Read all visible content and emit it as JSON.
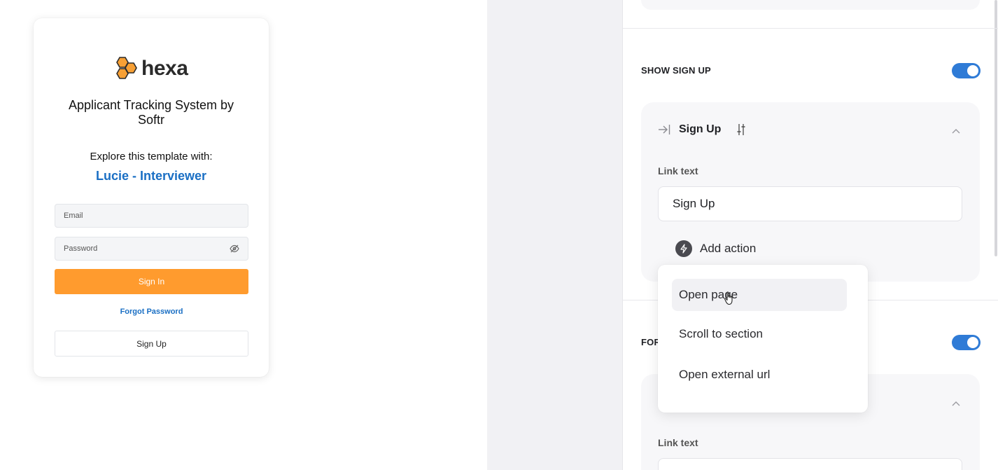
{
  "preview": {
    "logo_text": "hexa",
    "app_title": "Applicant Tracking System by Softr",
    "explore_text": "Explore this template with:",
    "persona": "Lucie - Interviewer",
    "email_placeholder": "Email",
    "password_placeholder": "Password",
    "signin_label": "Sign In",
    "forgot_label": "Forgot Password",
    "signup_label": "Sign Up"
  },
  "panel": {
    "show_signup_label": "SHOW SIGN UP",
    "show_signup_enabled": true,
    "signup_box": {
      "title": "Sign Up",
      "link_text_label": "Link text",
      "link_text_value": "Sign Up",
      "add_action_label": "Add action"
    },
    "next_section_label": "FOR",
    "next_section_enabled": true,
    "next_box": {
      "link_text_label": "Link text"
    }
  },
  "action_menu": {
    "items": [
      "Open page",
      "Scroll to section",
      "Open external url"
    ],
    "hovered_index": 0
  },
  "colors": {
    "accent_blue": "#2f7bd6",
    "link_blue": "#1a6fc4",
    "signin_orange": "#ff9b2e",
    "logo_orange": "#f7a035"
  }
}
